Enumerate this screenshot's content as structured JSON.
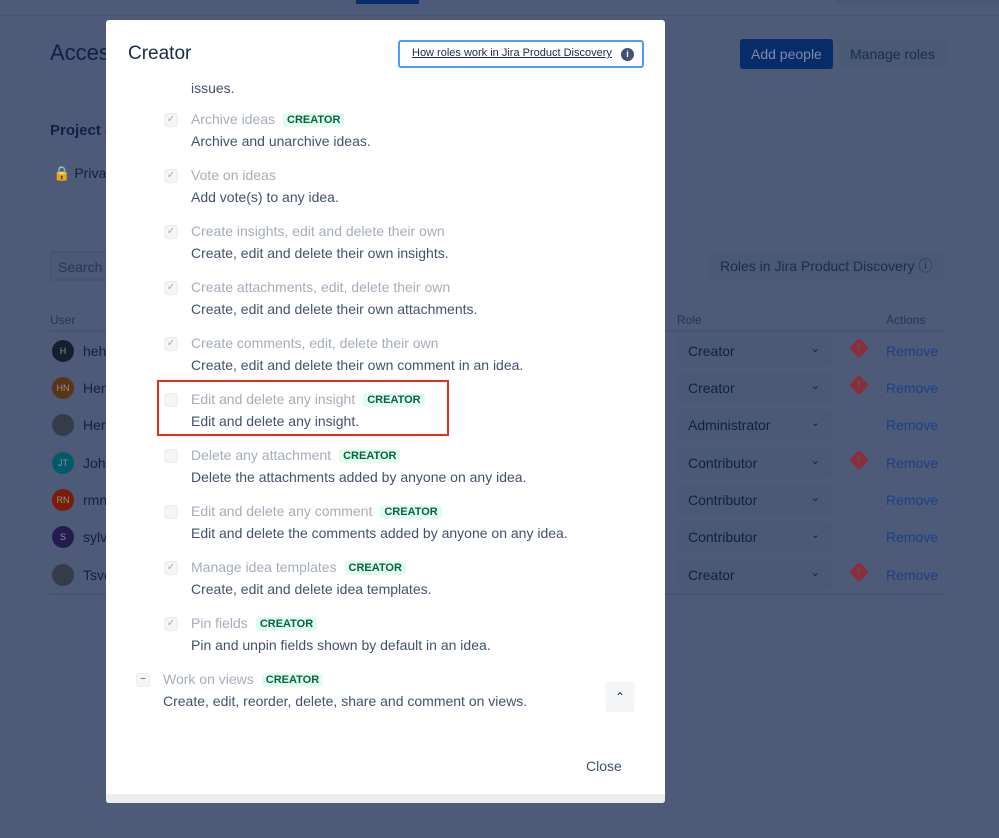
{
  "page": {
    "title": "Access",
    "add_people": "Add people",
    "manage_roles": "Manage roles",
    "project_access": "Project access",
    "privacy": "Private",
    "search_placeholder": "Search for users",
    "roles_button": "Roles in Jira Product Discovery",
    "columns": {
      "user": "User",
      "role": "Role",
      "actions": "Actions"
    },
    "users": [
      {
        "initials": "H",
        "name": "hehe",
        "color": "#253858",
        "role": "Creator",
        "warning": true,
        "action": "Remove"
      },
      {
        "initials": "HN",
        "name": "Hera N",
        "color": "#a1602c",
        "role": "Creator",
        "warning": true,
        "action": "Remove"
      },
      {
        "initials": "",
        "name": "Hera",
        "color": "#5e6c84",
        "role": "Administrator",
        "warning": false,
        "action": "Remove"
      },
      {
        "initials": "JT",
        "name": "John T",
        "color": "#00a3bf",
        "role": "Contributor",
        "warning": true,
        "action": "Remove"
      },
      {
        "initials": "RN",
        "name": "rmn",
        "color": "#de350b",
        "role": "Contributor",
        "warning": false,
        "action": "Remove"
      },
      {
        "initials": "S",
        "name": "sylvie",
        "color": "#403294",
        "role": "Contributor",
        "warning": false,
        "action": "Remove"
      },
      {
        "initials": "",
        "name": "Tsvet",
        "color": "#5e6c84",
        "role": "Creator",
        "warning": true,
        "action": "Remove"
      }
    ]
  },
  "modal": {
    "title": "Creator",
    "help_link": "How roles work in Jira Product Discovery",
    "fragment": "issues.",
    "close": "Close",
    "badge": "CREATOR",
    "permissions": [
      {
        "title": "Archive ideas",
        "badge": true,
        "checked": true,
        "desc": "Archive and unarchive ideas."
      },
      {
        "title": "Vote on ideas",
        "badge": false,
        "checked": true,
        "desc": "Add vote(s) to any idea."
      },
      {
        "title": "Create insights, edit and delete their own",
        "badge": false,
        "checked": true,
        "desc": "Create, edit and delete their own insights."
      },
      {
        "title": "Create attachments, edit, delete their own",
        "badge": false,
        "checked": true,
        "desc": "Create, edit and delete their own attachments."
      },
      {
        "title": "Create comments, edit, delete their own",
        "badge": false,
        "checked": true,
        "desc": "Create, edit and delete their own comment in an idea."
      },
      {
        "title": "Edit and delete any insight",
        "badge": true,
        "checked": false,
        "desc": "Edit and delete any insight.",
        "highlighted": true
      },
      {
        "title": "Delete any attachment",
        "badge": true,
        "checked": false,
        "desc": "Delete the attachments added by anyone on any idea."
      },
      {
        "title": "Edit and delete any comment",
        "badge": true,
        "checked": false,
        "desc": "Edit and delete the comments added by anyone on any idea."
      },
      {
        "title": "Manage idea templates",
        "badge": true,
        "checked": true,
        "desc": "Create, edit and delete idea templates."
      },
      {
        "title": "Pin fields",
        "badge": true,
        "checked": true,
        "desc": "Pin and unpin fields shown by default in an idea."
      }
    ],
    "group": {
      "title": "Work on views",
      "badge": true,
      "state": "partial",
      "desc": "Create, edit, reorder, delete, share and comment on views."
    }
  }
}
